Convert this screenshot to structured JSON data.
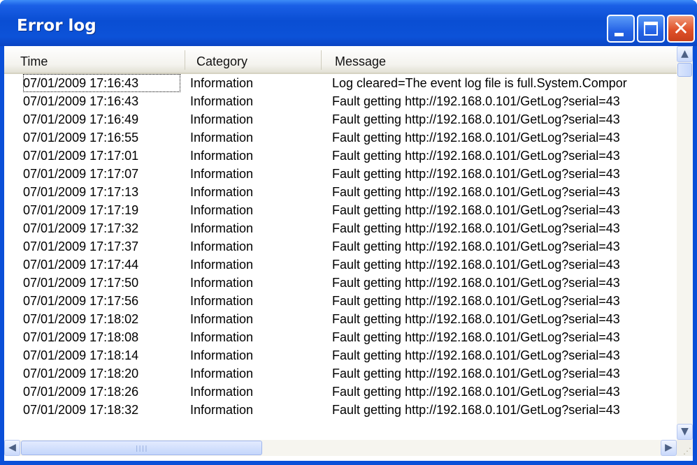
{
  "window": {
    "title": "Error log",
    "colors": {
      "titlebar": "#0a4ed3",
      "close_button": "#e0522a",
      "header_bg": "#ece9d8"
    }
  },
  "table": {
    "columns": [
      "Time",
      "Category",
      "Message"
    ],
    "rows": [
      {
        "time": "07/01/2009 17:16:43",
        "category": "Information",
        "message": "Log cleared=The event log file is full.System.Compor"
      },
      {
        "time": "07/01/2009 17:16:43",
        "category": "Information",
        "message": "Fault getting http://192.168.0.101/GetLog?serial=43"
      },
      {
        "time": "07/01/2009 17:16:49",
        "category": "Information",
        "message": "Fault getting http://192.168.0.101/GetLog?serial=43"
      },
      {
        "time": "07/01/2009 17:16:55",
        "category": "Information",
        "message": "Fault getting http://192.168.0.101/GetLog?serial=43"
      },
      {
        "time": "07/01/2009 17:17:01",
        "category": "Information",
        "message": "Fault getting http://192.168.0.101/GetLog?serial=43"
      },
      {
        "time": "07/01/2009 17:17:07",
        "category": "Information",
        "message": "Fault getting http://192.168.0.101/GetLog?serial=43"
      },
      {
        "time": "07/01/2009 17:17:13",
        "category": "Information",
        "message": "Fault getting http://192.168.0.101/GetLog?serial=43"
      },
      {
        "time": "07/01/2009 17:17:19",
        "category": "Information",
        "message": "Fault getting http://192.168.0.101/GetLog?serial=43"
      },
      {
        "time": "07/01/2009 17:17:32",
        "category": "Information",
        "message": "Fault getting http://192.168.0.101/GetLog?serial=43"
      },
      {
        "time": "07/01/2009 17:17:37",
        "category": "Information",
        "message": "Fault getting http://192.168.0.101/GetLog?serial=43"
      },
      {
        "time": "07/01/2009 17:17:44",
        "category": "Information",
        "message": "Fault getting http://192.168.0.101/GetLog?serial=43"
      },
      {
        "time": "07/01/2009 17:17:50",
        "category": "Information",
        "message": "Fault getting http://192.168.0.101/GetLog?serial=43"
      },
      {
        "time": "07/01/2009 17:17:56",
        "category": "Information",
        "message": "Fault getting http://192.168.0.101/GetLog?serial=43"
      },
      {
        "time": "07/01/2009 17:18:02",
        "category": "Information",
        "message": "Fault getting http://192.168.0.101/GetLog?serial=43"
      },
      {
        "time": "07/01/2009 17:18:08",
        "category": "Information",
        "message": "Fault getting http://192.168.0.101/GetLog?serial=43"
      },
      {
        "time": "07/01/2009 17:18:14",
        "category": "Information",
        "message": "Fault getting http://192.168.0.101/GetLog?serial=43"
      },
      {
        "time": "07/01/2009 17:18:20",
        "category": "Information",
        "message": "Fault getting http://192.168.0.101/GetLog?serial=43"
      },
      {
        "time": "07/01/2009 17:18:26",
        "category": "Information",
        "message": "Fault getting http://192.168.0.101/GetLog?serial=43"
      },
      {
        "time": "07/01/2009 17:18:32",
        "category": "Information",
        "message": "Fault getting http://192.168.0.101/GetLog?serial=43"
      }
    ]
  },
  "icons": {
    "minimize": "minimize-icon",
    "maximize": "maximize-icon",
    "close": "close-icon",
    "scroll_up": "arrow-up-icon",
    "scroll_down": "arrow-down-icon",
    "scroll_left": "arrow-left-icon",
    "scroll_right": "arrow-right-icon",
    "grip": "size-grip-icon"
  }
}
